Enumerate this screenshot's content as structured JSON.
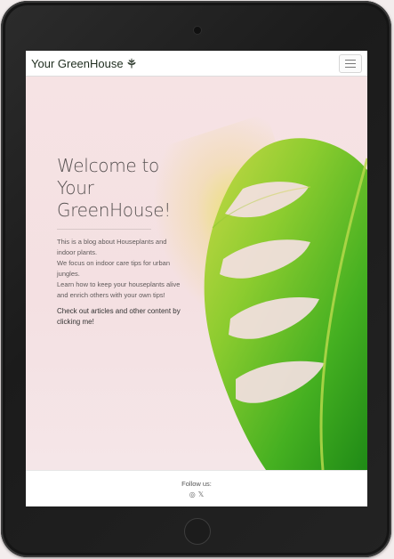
{
  "navbar": {
    "brand": "Your GreenHouse",
    "brand_icon": "seedling-icon",
    "toggler_icon": "hamburger-icon"
  },
  "hero": {
    "title": "Welcome to Your GreenHouse!",
    "description_lines": [
      "This is a blog about Houseplants and indoor plants.",
      "We focus on indoor care tips for urban jungles.",
      "Learn how to keep your houseplants alive and enrich others with your own tips!"
    ],
    "cta": "Check out articles and other content by clicking me!"
  },
  "footer": {
    "label": "Follow us:",
    "social_icons": [
      "instagram-icon",
      "x-icon"
    ]
  },
  "colors": {
    "hero_background": "#f5e2e4",
    "leaf_green": "#3fae2a"
  }
}
